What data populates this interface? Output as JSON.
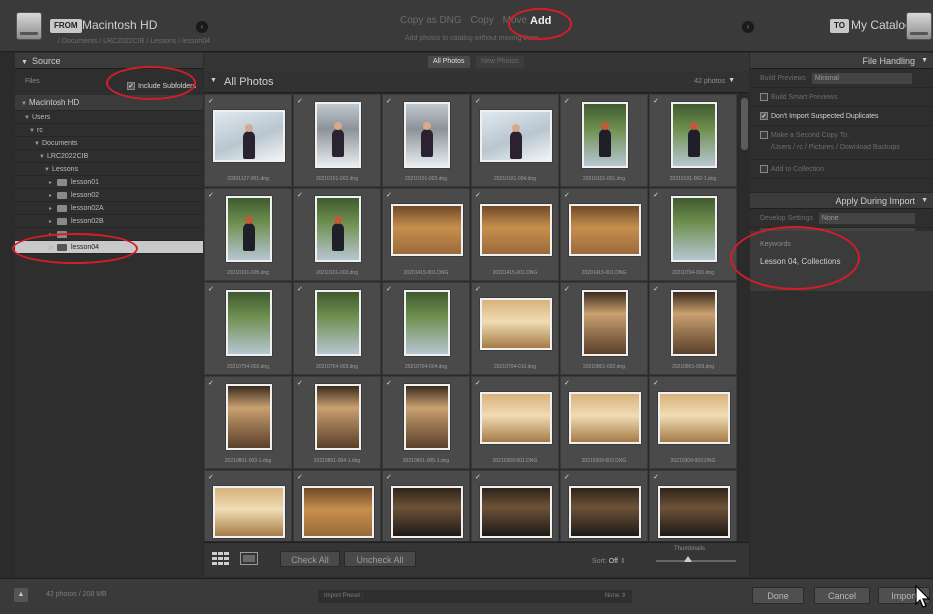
{
  "topbar": {
    "from_chip": "FROM",
    "from_location": "Macintosh HD",
    "from_path": "/ Documents / LRC2022CIB / Lessons / lesson04",
    "modes": [
      "Copy as DNG",
      "Copy",
      "Move"
    ],
    "active_mode": "Add",
    "mode_subtitle": "Add photos to catalog without moving them",
    "to_chip": "TO",
    "to_location": "My Catalog"
  },
  "source": {
    "title": "Source",
    "files_label": "Files",
    "include_subfolders": "Include Subfolders",
    "volume": "Macintosh HD",
    "tree": [
      {
        "label": "Users",
        "indent": 1
      },
      {
        "label": "rc",
        "indent": 2
      },
      {
        "label": "Documents",
        "indent": 3
      },
      {
        "label": "LRC2022CIB",
        "indent": 4
      },
      {
        "label": "Lessons",
        "indent": 5
      },
      {
        "label": "lesson01",
        "indent": 6
      },
      {
        "label": "lesson02",
        "indent": 6
      },
      {
        "label": "lesson02A",
        "indent": 6
      },
      {
        "label": "lesson02B",
        "indent": 6
      },
      {
        "label": "",
        "indent": 6
      },
      {
        "label": "lesson04",
        "indent": 6,
        "selected": true
      }
    ]
  },
  "grid": {
    "tabs": [
      "All Photos",
      "New Photos"
    ],
    "title": "All Photos",
    "count": "42 photos",
    "photos": [
      {
        "name": "20201127-001.dng",
        "style": "snow",
        "orient": "land"
      },
      {
        "name": "20210101-002.dng",
        "style": "winter",
        "orient": "port"
      },
      {
        "name": "20210101-003.dng",
        "style": "winter",
        "orient": "port"
      },
      {
        "name": "20210101-004.dng",
        "style": "snow",
        "orient": "land"
      },
      {
        "name": "20210101-001.dng",
        "style": "lawn",
        "orient": "port",
        "fig": "red"
      },
      {
        "name": "20210101-002-1.dng",
        "style": "lawn",
        "orient": "port",
        "fig": "red"
      },
      {
        "name": "20210101-005.dng",
        "style": "lawn",
        "orient": "port",
        "fig": "red"
      },
      {
        "name": "20210101-003.dng",
        "style": "lawn",
        "orient": "port",
        "fig": "red"
      },
      {
        "name": "20201415-001.DNG",
        "style": "room",
        "orient": "land"
      },
      {
        "name": "20201415-001.DNG",
        "style": "room",
        "orient": "land"
      },
      {
        "name": "20201415-001.DNG",
        "style": "room",
        "orient": "land"
      },
      {
        "name": "20210704-001.dng",
        "style": "lawn",
        "orient": "port"
      },
      {
        "name": "20210704-002.dng",
        "style": "lawn",
        "orient": "port"
      },
      {
        "name": "20210704-003.dng",
        "style": "lawn",
        "orient": "port"
      },
      {
        "name": "20210704-004.dng",
        "style": "lawn",
        "orient": "port"
      },
      {
        "name": "20210704-010.dng",
        "style": "bright",
        "orient": "land"
      },
      {
        "name": "20210801-002.dng",
        "style": "window",
        "orient": "port"
      },
      {
        "name": "20210801-003.dng",
        "style": "window",
        "orient": "port"
      },
      {
        "name": "20210801-003-1.dng",
        "style": "window",
        "orient": "port"
      },
      {
        "name": "20210801-004-1.dng",
        "style": "window",
        "orient": "port"
      },
      {
        "name": "20210801-005-1.dng",
        "style": "window",
        "orient": "port"
      },
      {
        "name": "20210309-001.DNG",
        "style": "bright",
        "orient": "land"
      },
      {
        "name": "20210309-002.DNG",
        "style": "bright",
        "orient": "land"
      },
      {
        "name": "20210309-003.DNG",
        "style": "bright",
        "orient": "land"
      },
      {
        "name": "",
        "style": "bright",
        "orient": "land"
      },
      {
        "name": "",
        "style": "room",
        "orient": "land"
      },
      {
        "name": "",
        "style": "group",
        "orient": "land"
      },
      {
        "name": "",
        "style": "group",
        "orient": "land"
      },
      {
        "name": "",
        "style": "group",
        "orient": "land"
      },
      {
        "name": "",
        "style": "group",
        "orient": "land"
      }
    ],
    "check_all": "Check All",
    "uncheck_all": "Uncheck All",
    "sort_label": "Sort:",
    "sort_value": "Off",
    "thumbnails_label": "Thumbnails",
    "thumbnail_size": 0.4
  },
  "right": {
    "file_handling": "File Handling",
    "build_previews_label": "Build Previews",
    "build_previews_value": "Minimal",
    "smart_previews": "Build Smart Previews",
    "dont_import_duplicates": "Don't Import Suspected Duplicates",
    "second_copy": "Make a Second Copy To:",
    "second_copy_path": "/Users / rc / Pictures / Download Backups",
    "add_to_collection": "Add to Collection",
    "apply_during_import": "Apply During Import",
    "develop_settings_label": "Develop Settings",
    "develop_settings_value": "None",
    "keywords_label": "Keywords",
    "keywords_value": "Lesson 04, Collections"
  },
  "bottombar": {
    "status": "42 photos / 208 MB",
    "import_preset_label": "Import Preset :",
    "import_preset_value": "None",
    "done": "Done",
    "cancel": "Cancel",
    "import": "Import"
  },
  "colors": {
    "annotation": "#d41d2a",
    "panel": "#2e2e2e",
    "cell": "#4a4a4a"
  }
}
